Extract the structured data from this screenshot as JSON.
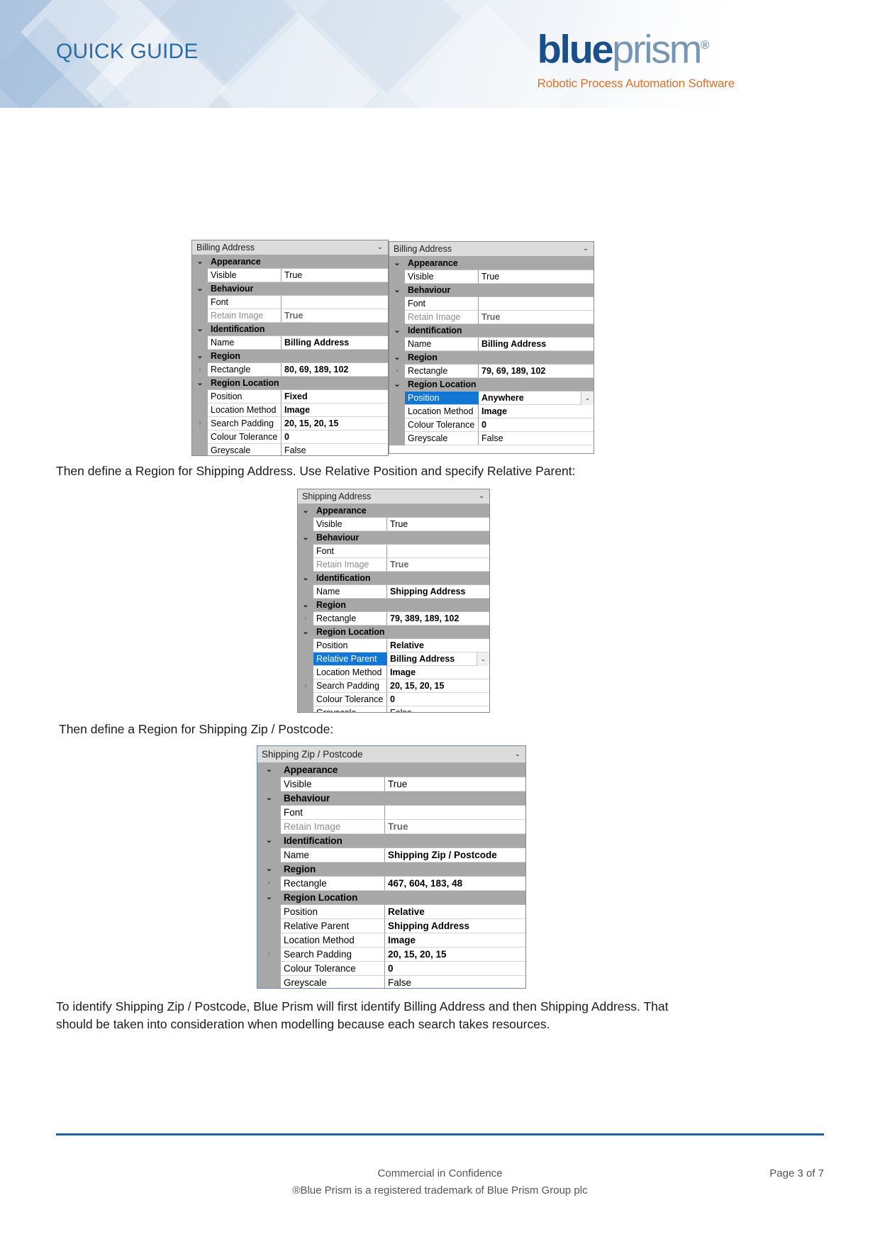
{
  "header": {
    "doc_label": "QUICK GUIDE",
    "logo_blue": "blue",
    "logo_prism": "prism",
    "logo_registered": "®",
    "logo_tagline": "Robotic Process Automation Software",
    "brand_blue": "#1a4f8a",
    "brand_grey_blue": "#7795b4",
    "brand_orange": "#e0702a"
  },
  "paragraphs": {
    "p1": "Then define a Region for Shipping Address. Use Relative Position and specify Relative Parent:",
    "p2": "Then define a Region for Shipping Zip / Postcode:",
    "p3_line1": "To identify Shipping Zip / Postcode, Blue Prism will first identify Billing Address and then Shipping Address. That",
    "p3_line2": "should be taken into consideration when modelling because each search takes resources."
  },
  "labels": {
    "appearance": "Appearance",
    "behaviour": "Behaviour",
    "identification": "Identification",
    "region": "Region",
    "region_location": "Region Location",
    "visible": "Visible",
    "font": "Font",
    "retain_image": "Retain Image",
    "name": "Name",
    "rectangle": "Rectangle",
    "position": "Position",
    "relative_parent": "Relative Parent",
    "location_method": "Location Method",
    "search_padding": "Search Padding",
    "colour_tolerance": "Colour Tolerance",
    "greyscale": "Greyscale",
    "expander_collapsed": "›",
    "expander_expanded": "⌄",
    "dropdown_caret": "⌄"
  },
  "grids": {
    "billing_fixed": {
      "title": "Billing Address",
      "visible": "True",
      "font": "",
      "retain_image": "True",
      "name": "Billing Address",
      "rectangle": "80, 69, 189, 102",
      "position": "Fixed",
      "location_method": "Image",
      "search_padding": "20, 15, 20, 15",
      "colour_tolerance": "0",
      "greyscale": "False",
      "selected_row": ""
    },
    "billing_anywhere": {
      "title": "Billing Address",
      "visible": "True",
      "font": "",
      "retain_image": "True",
      "name": "Billing Address",
      "rectangle": "79, 69, 189, 102",
      "position": "Anywhere",
      "location_method": "Image",
      "colour_tolerance": "0",
      "greyscale": "False",
      "selected_row": "Position"
    },
    "shipping_address": {
      "title": "Shipping Address",
      "visible": "True",
      "font": "",
      "retain_image": "True",
      "name": "Shipping Address",
      "rectangle": "79, 389, 189, 102",
      "position": "Relative",
      "relative_parent": "Billing Address",
      "location_method": "Image",
      "search_padding": "20, 15, 20, 15",
      "colour_tolerance": "0",
      "greyscale": "False",
      "selected_row": "Relative Parent"
    },
    "shipping_zip": {
      "title": "Shipping Zip / Postcode",
      "visible": "True",
      "font": "",
      "retain_image": "True",
      "name": "Shipping Zip / Postcode",
      "rectangle": "467, 604, 183, 48",
      "position": "Relative",
      "relative_parent": "Shipping Address",
      "location_method": "Image",
      "search_padding": "20, 15, 20, 15",
      "colour_tolerance": "0",
      "greyscale": "False",
      "selected_row": ""
    }
  },
  "footer": {
    "confidence": "Commercial in Confidence",
    "trademark": "®Blue Prism is a registered trademark of Blue Prism Group plc",
    "page": "Page 3 of 7",
    "rule_color": "#1f5fa0"
  }
}
